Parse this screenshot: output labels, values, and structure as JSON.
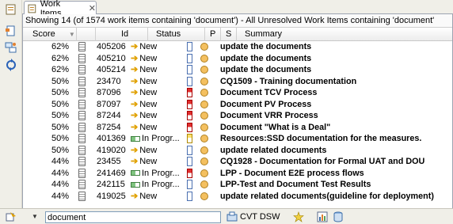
{
  "tab": {
    "label": "Work Items",
    "close": "✕"
  },
  "summary": "Showing 14 (of 1574 work items containing 'document') - All Unresolved Work Items containing 'document'",
  "columns": {
    "score": "Score",
    "id": "Id",
    "status": "Status",
    "p": "P",
    "s": "S",
    "summary": "Summary"
  },
  "rows": [
    {
      "score": "62%",
      "id": "405206",
      "status": "New",
      "priority": "normal",
      "summary": "update the documents"
    },
    {
      "score": "62%",
      "id": "405210",
      "status": "New",
      "priority": "normal",
      "summary": "update the documents"
    },
    {
      "score": "62%",
      "id": "405214",
      "status": "New",
      "priority": "normal",
      "summary": "update the documents"
    },
    {
      "score": "50%",
      "id": "23470",
      "status": "New",
      "priority": "normal",
      "summary": "CQ1509 - Training documentation"
    },
    {
      "score": "50%",
      "id": "87096",
      "status": "New",
      "priority": "high",
      "summary": "Document TCV Process"
    },
    {
      "score": "50%",
      "id": "87097",
      "status": "New",
      "priority": "high",
      "summary": "Document PV Process"
    },
    {
      "score": "50%",
      "id": "87244",
      "status": "New",
      "priority": "high",
      "summary": "Document VRR Process"
    },
    {
      "score": "50%",
      "id": "87254",
      "status": "New",
      "priority": "high",
      "summary": "Document \"What is a Deal\""
    },
    {
      "score": "50%",
      "id": "401369",
      "status": "In Progr...",
      "priority": "medium",
      "summary": "Resources:SSD documentation for the measures."
    },
    {
      "score": "50%",
      "id": "419020",
      "status": "New",
      "priority": "normal",
      "summary": "update related documents"
    },
    {
      "score": "44%",
      "id": "23455",
      "status": "New",
      "priority": "normal",
      "summary": "CQ1928 - Documentation for Formal UAT and DOU"
    },
    {
      "score": "44%",
      "id": "241469",
      "status": "In Progr...",
      "priority": "high",
      "summary": "LPP - Document E2E process flows"
    },
    {
      "score": "44%",
      "id": "242115",
      "status": "In Progr...",
      "priority": "normal",
      "summary": "LPP-Test and Document Test Results"
    },
    {
      "score": "44%",
      "id": "419025",
      "status": "New",
      "priority": "normal",
      "summary": "update related documents(guideline for deployment)"
    }
  ],
  "bottom": {
    "search_value": "document",
    "project_label": "CVT DSW"
  },
  "colors": {
    "accent": "#e0a000",
    "priority_high": "#e03030",
    "severity": "#f4c060"
  }
}
